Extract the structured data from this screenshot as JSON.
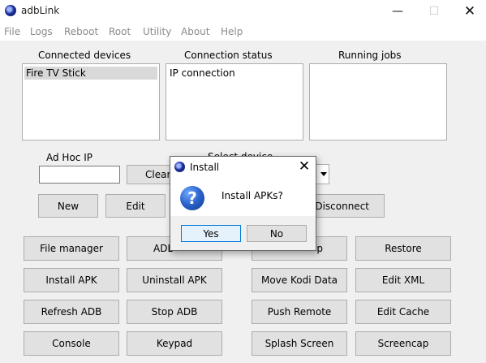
{
  "window": {
    "title": "adbLink",
    "minimize_glyph": "—",
    "maximize_glyph": "☐",
    "close_glyph": "✕"
  },
  "menu": [
    "File",
    "Logs",
    "Reboot",
    "Root",
    "Utility",
    "About",
    "Help"
  ],
  "panels": {
    "connected_devices": {
      "label": "Connected devices",
      "items": [
        "Fire TV Stick"
      ],
      "selected": "Fire TV Stick"
    },
    "connection_status": {
      "label": "Connection status",
      "items": [
        "IP connection"
      ]
    },
    "running_jobs": {
      "label": "Running jobs",
      "items": []
    }
  },
  "adhoc": {
    "label": "Ad Hoc IP",
    "value": "",
    "clear_label": "Clear"
  },
  "select_device": {
    "label": "Select device"
  },
  "device_buttons": {
    "new": "New",
    "edit": "Edit",
    "disconnect": "Disconnect"
  },
  "actions": {
    "file_manager": "File manager",
    "adb_partial": "ADB",
    "backup_partial": "p",
    "restore": "Restore",
    "install_apk": "Install APK",
    "uninstall_apk": "Uninstall APK",
    "move_kodi_data": "Move Kodi Data",
    "edit_xml": "Edit XML",
    "refresh_adb": "Refresh ADB",
    "stop_adb": "Stop ADB",
    "push_remote": "Push Remote",
    "edit_cache": "Edit Cache",
    "console": "Console",
    "keypad": "Keypad",
    "splash_screen": "Splash Screen",
    "screencap": "Screencap"
  },
  "dialog": {
    "title": "Install",
    "message": "Install APKs?",
    "icon_glyph": "?",
    "close_glyph": "✕",
    "yes": "Yes",
    "no": "No"
  },
  "icons": {
    "app": "adblink-logo-icon",
    "dialog_question": "question-icon",
    "combo_arrow": "chevron-down-icon"
  }
}
